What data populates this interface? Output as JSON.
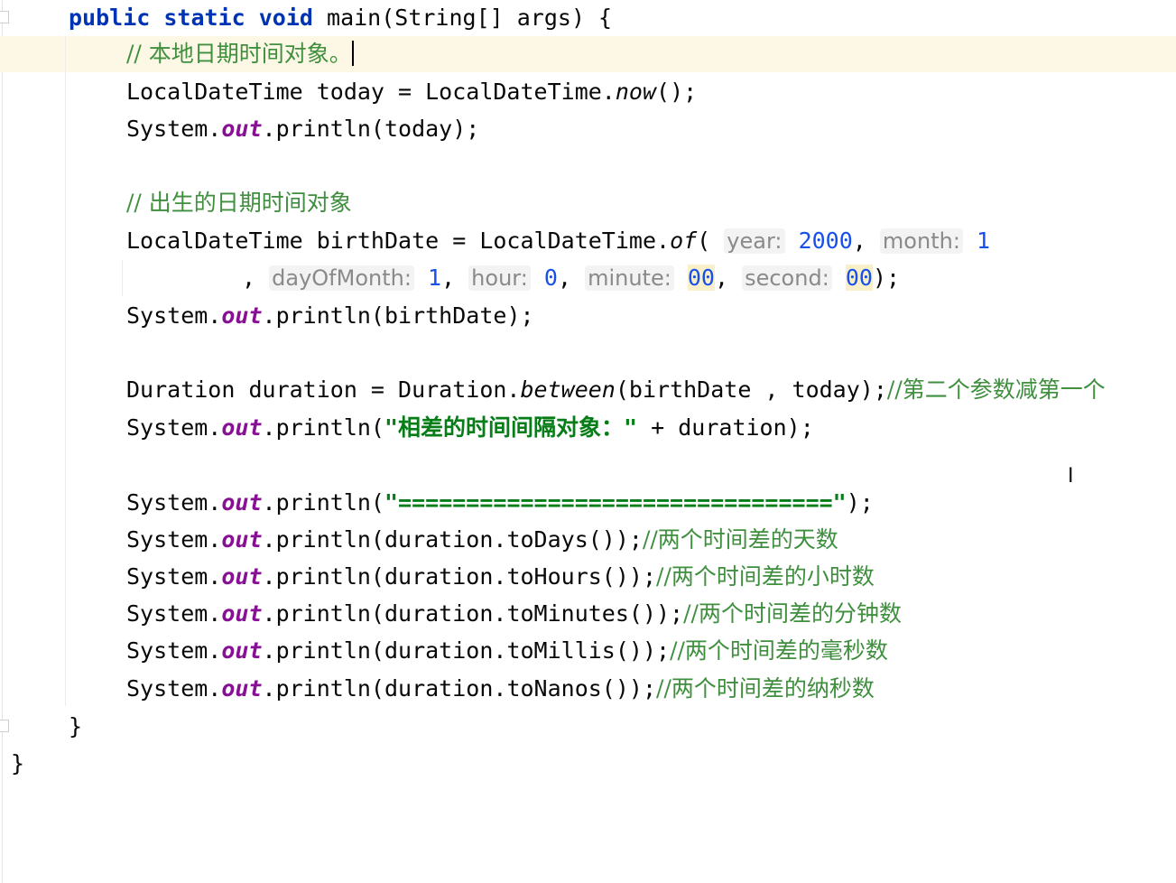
{
  "code": {
    "main_kw1": "public",
    "main_kw2": "static",
    "main_kw3": "void",
    "main_sig": " main(String[] args) {",
    "comment_today": "// 本地日期时间对象。",
    "today_decl_a": "LocalDateTime today = LocalDateTime.",
    "today_decl_m": "now",
    "today_decl_b": "();",
    "sys": "System.",
    "out": "out",
    "print_today": ".println(today);",
    "comment_birth": "// 出生的日期时间对象",
    "birth_decl_a": "LocalDateTime birthDate = LocalDateTime.",
    "birth_decl_m": "of",
    "paren_open": "(",
    "hint_year": "year:",
    "val_year": "2000",
    "comma": ",",
    "hint_month": "month:",
    "val_month": "1",
    "cont_comma": ",",
    "hint_day": "dayOfMonth:",
    "val_day": "1",
    "hint_hour": "hour:",
    "val_hour": "0",
    "hint_minute": "minute:",
    "val_minute": "00",
    "hint_second": "second:",
    "val_second": "00",
    "close_stmt": ");",
    "print_birth": ".println(birthDate);",
    "dur_decl_a": "Duration duration = Duration.",
    "dur_decl_m": "between",
    "dur_decl_b": "(birthDate , today);",
    "dur_comment": "//第二个参数减第一个",
    "print_open": ".println(",
    "str_diff": "\"相差的时间间隔对象：\"",
    "print_diff_tail": " + duration);",
    "str_sep": "\"================================\"",
    "print_close": ");",
    "days_call": ".println(duration.toDays());",
    "days_cmt": "//两个时间差的天数",
    "hours_call": ".println(duration.toHours());",
    "hours_cmt": "//两个时间差的小时数",
    "minutes_call": ".println(duration.toMinutes());",
    "minutes_cmt": "//两个时间差的分钟数",
    "millis_call": ".println(duration.toMillis());",
    "millis_cmt": "//两个时间差的毫秒数",
    "nanos_call": ".println(duration.toNanos());",
    "nanos_cmt": "//两个时间差的纳秒数",
    "close_method": "}",
    "close_class": "}"
  },
  "cursor_icon": "text-cursor-ibeam",
  "colors": {
    "keyword": "#0033b3",
    "field": "#871094",
    "string": "#067d17",
    "number": "#1750eb",
    "comment": "#3f8f3f",
    "current_line": "#fdf8e6"
  }
}
